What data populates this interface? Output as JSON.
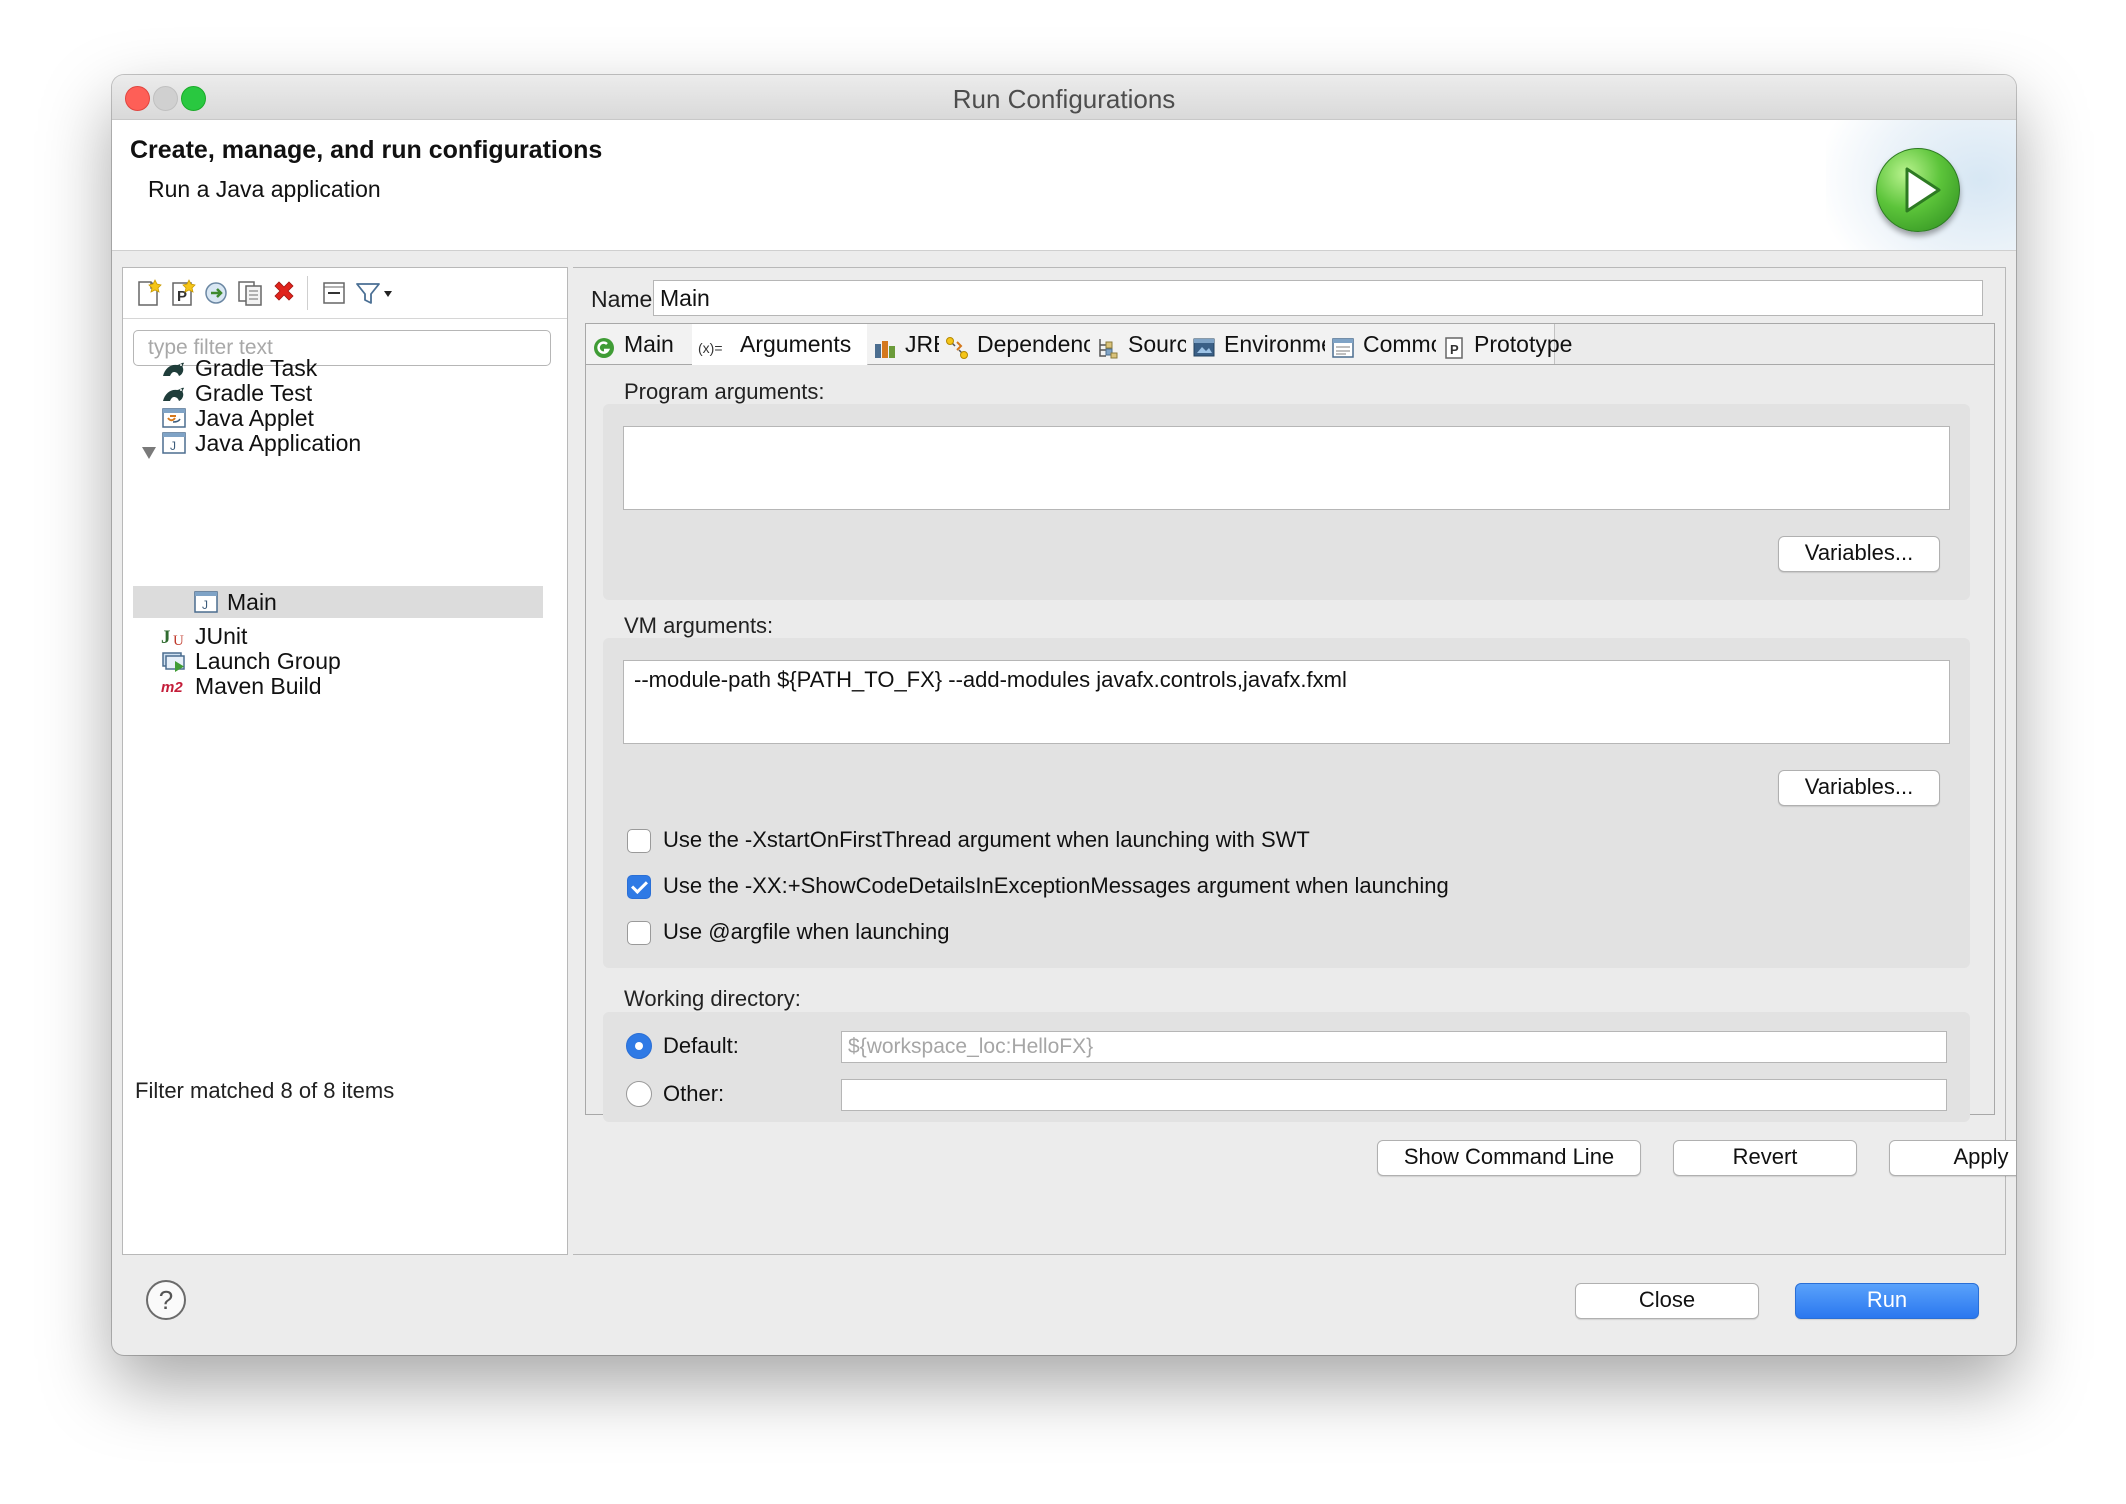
{
  "window": {
    "title": "Run Configurations"
  },
  "header": {
    "title": "Create, manage, and run configurations",
    "subtitle": "Run a Java application",
    "icon": "run-play-icon"
  },
  "left_toolbar": {
    "icons": [
      "new-config-icon",
      "new-prototype-icon",
      "export-icon",
      "duplicate-icon",
      "delete-icon",
      "collapse-all-icon",
      "filter-icon",
      "dropdown-arrow-icon"
    ]
  },
  "filter": {
    "placeholder": "type filter text",
    "value": ""
  },
  "tree": {
    "items": [
      {
        "label": "Gradle Task",
        "icon": "gradle-icon",
        "level": 0,
        "expanded": false,
        "selected": false
      },
      {
        "label": "Gradle Test",
        "icon": "gradle-icon",
        "level": 0,
        "expanded": false,
        "selected": false
      },
      {
        "label": "Java Applet",
        "icon": "java-applet-icon",
        "level": 0,
        "expanded": false,
        "selected": false
      },
      {
        "label": "Java Application",
        "icon": "java-application-icon",
        "level": 0,
        "expanded": true,
        "selected": false
      },
      {
        "label": "Main",
        "icon": "java-application-icon",
        "level": 1,
        "expanded": false,
        "selected": true
      },
      {
        "label": "JUnit",
        "icon": "junit-icon",
        "level": 0,
        "expanded": false,
        "selected": false
      },
      {
        "label": "Launch Group",
        "icon": "launch-group-icon",
        "level": 0,
        "expanded": false,
        "selected": false
      },
      {
        "label": "Maven Build",
        "icon": "maven-icon",
        "level": 0,
        "expanded": false,
        "selected": false
      }
    ],
    "status": "Filter matched 8 of 8 items"
  },
  "config": {
    "name_label": "Name:",
    "name_value": "Main",
    "active_tab": "Arguments",
    "tabs": [
      {
        "label": "Main",
        "icon": "main-tab-icon"
      },
      {
        "label": "Arguments",
        "icon": "arguments-icon"
      },
      {
        "label": "JRE",
        "icon": "jre-icon"
      },
      {
        "label": "Dependencies",
        "icon": "dependencies-icon"
      },
      {
        "label": "Source",
        "icon": "source-icon"
      },
      {
        "label": "Environment",
        "icon": "environment-icon"
      },
      {
        "label": "Common",
        "icon": "common-icon"
      },
      {
        "label": "Prototype",
        "icon": "prototype-icon"
      }
    ],
    "program_arguments_label": "Program arguments:",
    "program_arguments_value": "",
    "variables_label": "Variables...",
    "vm_arguments_label": "VM arguments:",
    "vm_arguments_value": "--module-path ${PATH_TO_FX} --add-modules javafx.controls,javafx.fxml",
    "options": [
      {
        "label": "Use the -XstartOnFirstThread argument when launching with SWT",
        "checked": false
      },
      {
        "label": "Use the -XX:+ShowCodeDetailsInExceptionMessages argument when launching",
        "checked": true
      },
      {
        "label": "Use @argfile when launching",
        "checked": false
      }
    ],
    "working_directory_label": "Working directory:",
    "wd_default_label": "Default:",
    "wd_default_value": "${workspace_loc:HelloFX}",
    "wd_default_selected": true,
    "wd_other_label": "Other:",
    "wd_other_value": ""
  },
  "actions": {
    "show_command_line": "Show Command Line",
    "revert": "Revert",
    "apply": "Apply"
  },
  "footer": {
    "help_icon": "help-icon",
    "close": "Close",
    "run": "Run"
  },
  "colors": {
    "accent": "#2a77ef",
    "selection": "#dcdcdc",
    "close_light": "#fe5f57",
    "min_light": "#d0d0d0",
    "max_light": "#29c840"
  }
}
